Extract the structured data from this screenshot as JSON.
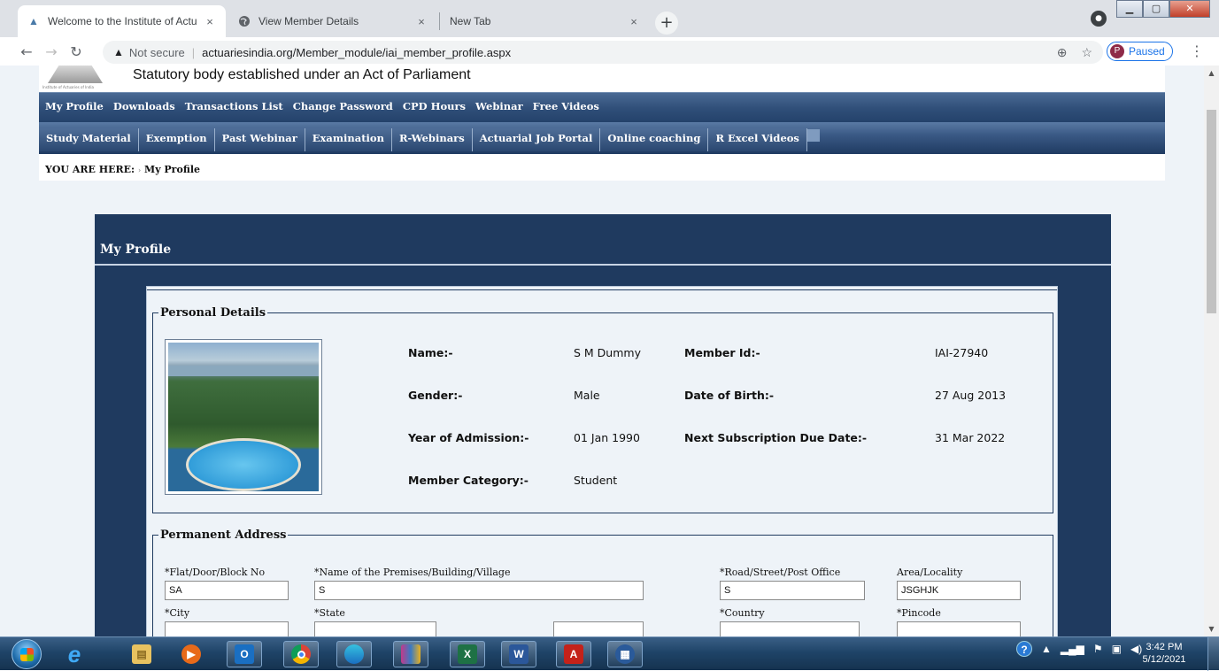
{
  "browser": {
    "tabs": [
      {
        "title": "Welcome to the Institute of Actu",
        "favicon": "iai-logo-icon",
        "active": true
      },
      {
        "title": "View Member Details",
        "favicon": "globe-icon",
        "active": false
      },
      {
        "title": "New Tab",
        "favicon": "",
        "active": false
      }
    ],
    "new_tab": "+",
    "close_glyph": "×",
    "security_label": "Not secure",
    "url": "actuariesindia.org/Member_module/iai_member_profile.aspx",
    "profile_initial": "P",
    "profile_status": "Paused"
  },
  "site": {
    "tagline": "Statutory body established under an Act of Parliament",
    "logo_caption": "Institute of Actuaries of India",
    "menu_primary": [
      "My Profile",
      "Downloads",
      "Transactions List",
      "Change Password",
      "CPD Hours",
      "Webinar",
      "Free Videos"
    ],
    "menu_secondary": [
      "Study Material",
      "Exemption",
      "Past Webinar",
      "Examination",
      "R-Webinars",
      "Actuarial Job Portal",
      "Online coaching",
      "R Excel Videos"
    ],
    "breadcrumb_prefix": "YOU ARE HERE:",
    "breadcrumb_arrow": "›",
    "breadcrumb_current": "My Profile"
  },
  "profile": {
    "panel_title": "My Profile",
    "personal_legend": "Personal Details",
    "fields": {
      "name_label": "Name:-",
      "name_value": "S M Dummy",
      "member_id_label": "Member Id:-",
      "member_id_value": "IAI-27940",
      "gender_label": "Gender:-",
      "gender_value": "Male",
      "dob_label": "Date of Birth:-",
      "dob_value": "27 Aug 2013",
      "admission_label": "Year of Admission:-",
      "admission_value": "01 Jan 1990",
      "due_label": "Next Subscription Due Date:-",
      "due_value": "31 Mar 2022",
      "category_label": "Member Category:-",
      "category_value": "Student"
    },
    "address_legend": "Permanent Address",
    "address": {
      "flat_label": "*Flat/Door/Block No",
      "flat_value": "SA",
      "premises_label": "*Name of the Premises/Building/Village",
      "premises_value": "S",
      "road_label": "*Road/Street/Post Office",
      "road_value": "S",
      "area_label": "Area/Locality",
      "area_value": "JSGHJK",
      "city_label": "*City",
      "state_label": "*State",
      "country_label": "*Country",
      "pincode_label": "*Pincode"
    }
  },
  "taskbar": {
    "time": "3:42 PM",
    "date": "5/12/2021"
  }
}
